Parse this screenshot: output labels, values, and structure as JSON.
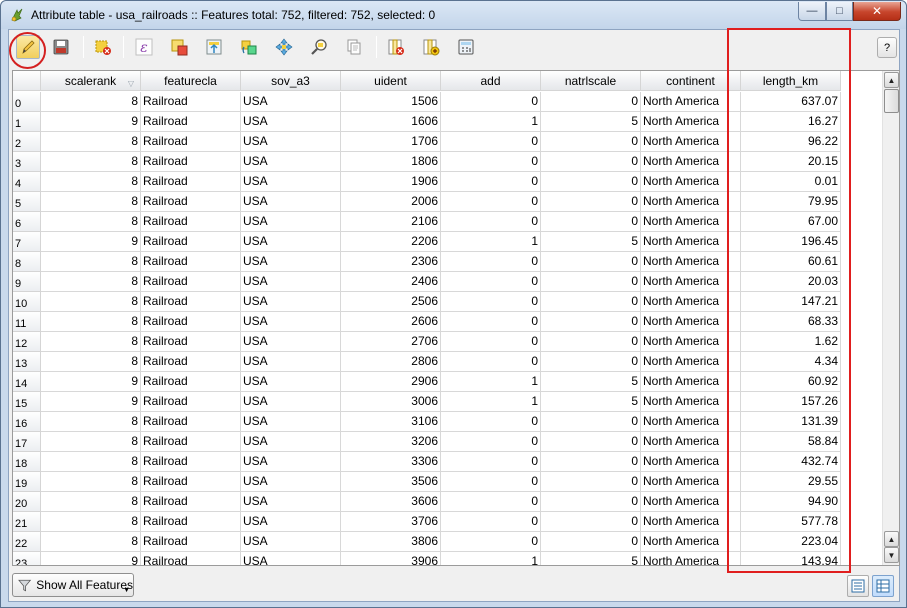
{
  "window": {
    "title": "Attribute table - usa_railroads :: Features total: 752, filtered: 752, selected: 0",
    "min_glyph": "—",
    "max_glyph": "□",
    "close_glyph": "✕"
  },
  "toolbar": {
    "buttons": [
      {
        "name": "toggle-editing-button",
        "icon": "pencil-icon",
        "pressed": true
      },
      {
        "name": "save-edits-button",
        "icon": "save-icon"
      },
      {
        "name": "delete-selected-button",
        "icon": "delete-features-icon"
      },
      {
        "name": "select-by-expression-button",
        "icon": "expression-icon"
      },
      {
        "name": "unselect-all-button",
        "icon": "deselect-icon"
      },
      {
        "name": "move-selection-to-top-button",
        "icon": "move-to-top-icon"
      },
      {
        "name": "invert-selection-button",
        "icon": "invert-selection-icon"
      },
      {
        "name": "pan-map-to-selection-button",
        "icon": "pan-icon"
      },
      {
        "name": "zoom-map-to-selection-button",
        "icon": "zoom-selection-icon"
      },
      {
        "name": "copy-selected-rows-button",
        "icon": "copy-icon"
      },
      {
        "name": "delete-column-button",
        "icon": "delete-column-icon"
      },
      {
        "name": "new-column-button",
        "icon": "new-column-icon"
      },
      {
        "name": "field-calculator-button",
        "icon": "field-calculator-icon"
      }
    ],
    "help_label": "?"
  },
  "table": {
    "columns": [
      "scalerank",
      "featurecla",
      "sov_a3",
      "uident",
      "add",
      "natrlscale",
      "continent",
      "length_km"
    ],
    "sorted_column": "scalerank",
    "sort_glyph": "▽",
    "rows": [
      {
        "id": "0",
        "cells": [
          "8",
          "Railroad",
          "USA",
          "1506",
          "0",
          "0",
          "North America",
          "637.07"
        ]
      },
      {
        "id": "1",
        "cells": [
          "9",
          "Railroad",
          "USA",
          "1606",
          "1",
          "5",
          "North America",
          "16.27"
        ]
      },
      {
        "id": "2",
        "cells": [
          "8",
          "Railroad",
          "USA",
          "1706",
          "0",
          "0",
          "North America",
          "96.22"
        ]
      },
      {
        "id": "3",
        "cells": [
          "8",
          "Railroad",
          "USA",
          "1806",
          "0",
          "0",
          "North America",
          "20.15"
        ]
      },
      {
        "id": "4",
        "cells": [
          "8",
          "Railroad",
          "USA",
          "1906",
          "0",
          "0",
          "North America",
          "0.01"
        ]
      },
      {
        "id": "5",
        "cells": [
          "8",
          "Railroad",
          "USA",
          "2006",
          "0",
          "0",
          "North America",
          "79.95"
        ]
      },
      {
        "id": "6",
        "cells": [
          "8",
          "Railroad",
          "USA",
          "2106",
          "0",
          "0",
          "North America",
          "67.00"
        ]
      },
      {
        "id": "7",
        "cells": [
          "9",
          "Railroad",
          "USA",
          "2206",
          "1",
          "5",
          "North America",
          "196.45"
        ]
      },
      {
        "id": "8",
        "cells": [
          "8",
          "Railroad",
          "USA",
          "2306",
          "0",
          "0",
          "North America",
          "60.61"
        ]
      },
      {
        "id": "9",
        "cells": [
          "8",
          "Railroad",
          "USA",
          "2406",
          "0",
          "0",
          "North America",
          "20.03"
        ]
      },
      {
        "id": "10",
        "cells": [
          "8",
          "Railroad",
          "USA",
          "2506",
          "0",
          "0",
          "North America",
          "147.21"
        ]
      },
      {
        "id": "11",
        "cells": [
          "8",
          "Railroad",
          "USA",
          "2606",
          "0",
          "0",
          "North America",
          "68.33"
        ]
      },
      {
        "id": "12",
        "cells": [
          "8",
          "Railroad",
          "USA",
          "2706",
          "0",
          "0",
          "North America",
          "1.62"
        ]
      },
      {
        "id": "13",
        "cells": [
          "8",
          "Railroad",
          "USA",
          "2806",
          "0",
          "0",
          "North America",
          "4.34"
        ]
      },
      {
        "id": "14",
        "cells": [
          "9",
          "Railroad",
          "USA",
          "2906",
          "1",
          "5",
          "North America",
          "60.92"
        ]
      },
      {
        "id": "15",
        "cells": [
          "9",
          "Railroad",
          "USA",
          "3006",
          "1",
          "5",
          "North America",
          "157.26"
        ]
      },
      {
        "id": "16",
        "cells": [
          "8",
          "Railroad",
          "USA",
          "3106",
          "0",
          "0",
          "North America",
          "131.39"
        ]
      },
      {
        "id": "17",
        "cells": [
          "8",
          "Railroad",
          "USA",
          "3206",
          "0",
          "0",
          "North America",
          "58.84"
        ]
      },
      {
        "id": "18",
        "cells": [
          "8",
          "Railroad",
          "USA",
          "3306",
          "0",
          "0",
          "North America",
          "432.74"
        ]
      },
      {
        "id": "19",
        "cells": [
          "8",
          "Railroad",
          "USA",
          "3506",
          "0",
          "0",
          "North America",
          "29.55"
        ]
      },
      {
        "id": "20",
        "cells": [
          "8",
          "Railroad",
          "USA",
          "3606",
          "0",
          "0",
          "North America",
          "94.90"
        ]
      },
      {
        "id": "21",
        "cells": [
          "8",
          "Railroad",
          "USA",
          "3706",
          "0",
          "0",
          "North America",
          "577.78"
        ]
      },
      {
        "id": "22",
        "cells": [
          "8",
          "Railroad",
          "USA",
          "3806",
          "0",
          "0",
          "North America",
          "223.04"
        ]
      },
      {
        "id": "23",
        "cells": [
          "9",
          "Railroad",
          "USA",
          "3906",
          "1",
          "5",
          "North America",
          "143.94"
        ]
      }
    ]
  },
  "bottom": {
    "filter_label": "Show All Features",
    "filter_arrow": "▼"
  },
  "scrollbar": {
    "up_glyph": "▲",
    "down_glyph": "▼"
  },
  "colors": {
    "annotation": "#e01e1e",
    "window_frame": "#c9d9ec"
  }
}
